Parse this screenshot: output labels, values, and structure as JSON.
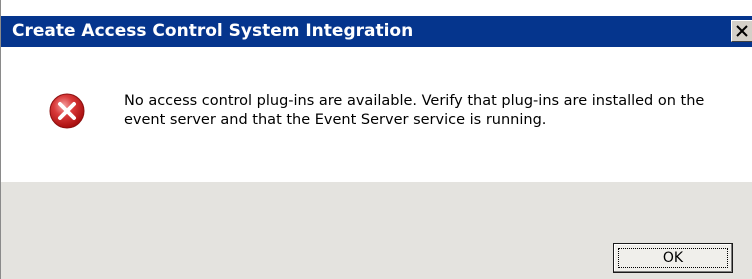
{
  "window": {
    "title": "Create Access Control System Integration",
    "title_bar_color": "#05358d",
    "close_icon": "close-icon"
  },
  "dialog": {
    "icon": "error-icon",
    "icon_color": "#c81e1e",
    "message": "No access control plug-ins are available. Verify that plug-ins are installed on the event server and that the Event Server service is running."
  },
  "buttons": {
    "ok_label": "OK"
  }
}
